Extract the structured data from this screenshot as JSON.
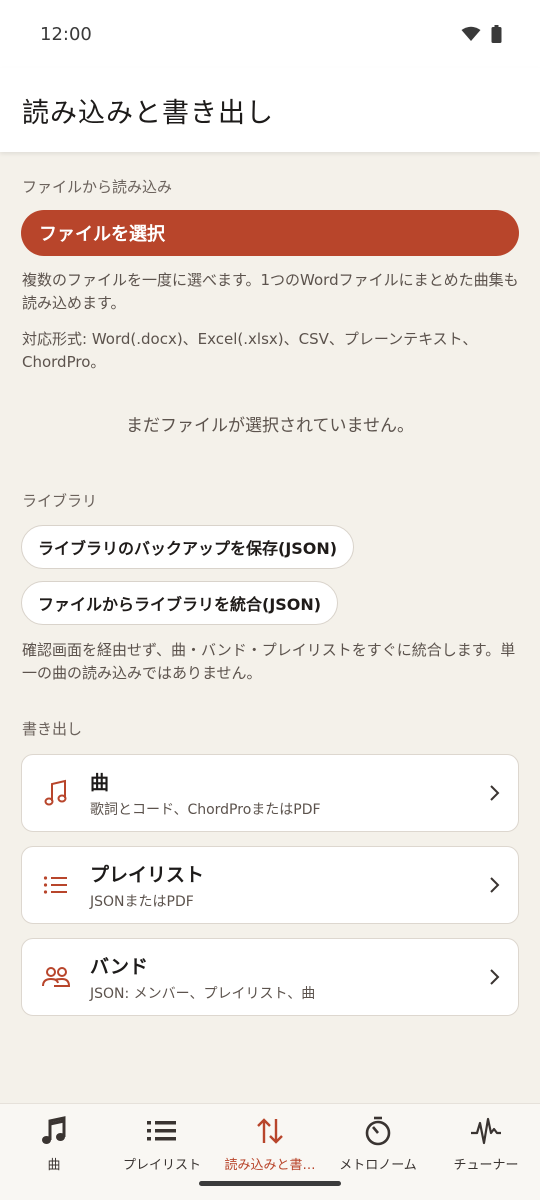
{
  "status": {
    "time": "12:00"
  },
  "header": {
    "title": "読み込みと書き出し"
  },
  "import": {
    "section_label": "ファイルから読み込み",
    "select_button": "ファイルを選択",
    "help1": "複数のファイルを一度に選べます。1つのWordファイルにまとめた曲集も読み込めます。",
    "help2": "対応形式: Word(.docx)、Excel(.xlsx)、CSV、プレーンテキスト、ChordPro。",
    "empty": "まだファイルが選択されていません。"
  },
  "library": {
    "section_label": "ライブラリ",
    "backup_button": "ライブラリのバックアップを保存(JSON)",
    "merge_button": "ファイルからライブラリを統合(JSON)",
    "help": "確認画面を経由せず、曲・バンド・プレイリストをすぐに統合します。単一の曲の読み込みではありません。"
  },
  "export": {
    "section_label": "書き出し",
    "items": [
      {
        "title": "曲",
        "subtitle": "歌詞とコード、ChordProまたはPDF",
        "icon": "music-note-icon"
      },
      {
        "title": "プレイリスト",
        "subtitle": "JSONまたはPDF",
        "icon": "list-icon"
      },
      {
        "title": "バンド",
        "subtitle": "JSON: メンバー、プレイリスト、曲",
        "icon": "people-icon"
      }
    ]
  },
  "nav": {
    "items": [
      {
        "label": "曲",
        "icon": "music-note-icon"
      },
      {
        "label": "プレイリスト",
        "icon": "list-icon"
      },
      {
        "label": "読み込みと書…",
        "icon": "import-export-icon",
        "active": true
      },
      {
        "label": "メトロノーム",
        "icon": "timer-icon"
      },
      {
        "label": "チューナー",
        "icon": "waveform-icon"
      }
    ]
  },
  "colors": {
    "accent": "#b8452b",
    "background": "#f4f1ea"
  }
}
